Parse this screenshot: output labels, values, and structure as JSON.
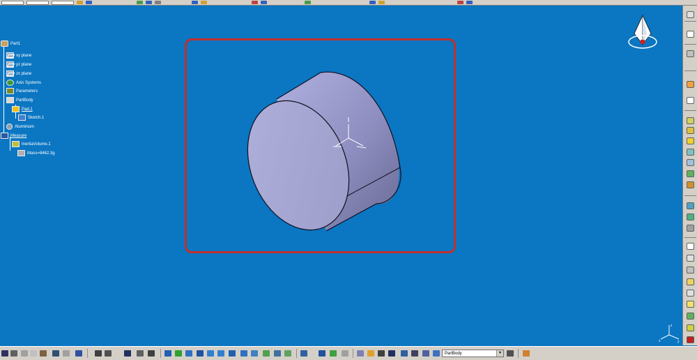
{
  "spec_tree": {
    "nodes": [
      {
        "label": "Part1",
        "icon": "part-icon"
      },
      {
        "label": "xy plane",
        "icon": "plane-icon"
      },
      {
        "label": "yz plane",
        "icon": "plane-icon"
      },
      {
        "label": "zx plane",
        "icon": "plane-icon"
      },
      {
        "label": "Axis Systems",
        "icon": "axis-systems-icon"
      },
      {
        "label": "Parameters",
        "icon": "parameters-icon"
      },
      {
        "label": "PartBody",
        "icon": "body-icon"
      },
      {
        "label": "Pad.1",
        "icon": "pad-icon"
      },
      {
        "label": "Sketch.1",
        "icon": "sketch-icon"
      },
      {
        "label": "Aluminium",
        "icon": "material-icon"
      },
      {
        "label": "Measure",
        "icon": "measure-icon"
      },
      {
        "label": "InertiaVolume.1",
        "icon": "inertia-icon"
      },
      {
        "label": "Mass=8462.3g",
        "icon": "mass-icon"
      }
    ]
  },
  "bottom_toolbar": {
    "current_body": "PartBody"
  },
  "colors": {
    "background": "#0b76c2",
    "highlight": "#c0302d",
    "solid_face": "#a0a0d0"
  }
}
